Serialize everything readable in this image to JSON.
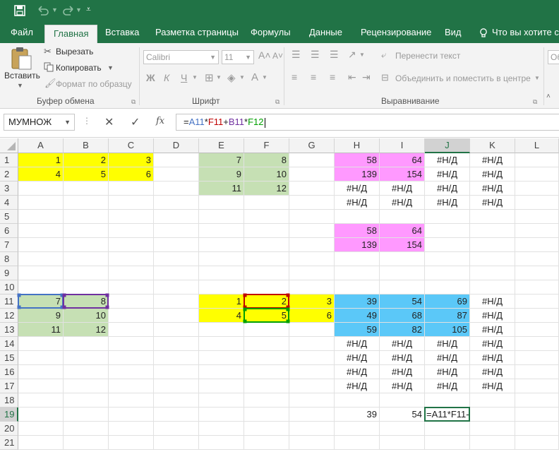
{
  "colors": {
    "accent": "#217346",
    "yellow": "#ffff00",
    "green": "#c6e0b4",
    "pink": "#ff99ff",
    "blue": "#5bc8f8",
    "ref_blue": "#4472c4",
    "ref_purple": "#7030a0",
    "ref_red": "#c00000",
    "ref_green": "#00a000"
  },
  "tabs": [
    "Файл",
    "Главная",
    "Вставка",
    "Разметка страницы",
    "Формулы",
    "Данные",
    "Рецензирование",
    "Вид",
    "Что вы хотите сде"
  ],
  "ribbon": {
    "paste": "Вставить",
    "cut": "Вырезать",
    "copy": "Копировать",
    "format_painter": "Формат по образцу",
    "clipboard_group": "Буфер обмена",
    "font_name": "Calibri",
    "font_size": "11",
    "font_group": "Шрифт",
    "wrap_text": "Перенести текст",
    "merge_center": "Объединить и поместить в центре",
    "alignment_group": "Выравнивание",
    "right_edge": "Об"
  },
  "namebox": "МУМНОЖ",
  "formula": [
    {
      "t": "=",
      "c": "#222222"
    },
    {
      "t": "A11",
      "c": "#4472c4"
    },
    {
      "t": "*",
      "c": "#222222"
    },
    {
      "t": "F11",
      "c": "#c00000"
    },
    {
      "t": "+",
      "c": "#222222"
    },
    {
      "t": "B11",
      "c": "#7030a0"
    },
    {
      "t": "*",
      "c": "#222222"
    },
    {
      "t": "F12",
      "c": "#00a000"
    }
  ],
  "columns": [
    "A",
    "B",
    "C",
    "D",
    "E",
    "F",
    "G",
    "H",
    "I",
    "J",
    "K",
    "L"
  ],
  "rows": [
    "1",
    "2",
    "3",
    "4",
    "5",
    "6",
    "7",
    "8",
    "9",
    "10",
    "11",
    "12",
    "13",
    "14",
    "15",
    "16",
    "17",
    "18",
    "19",
    "20",
    "21"
  ],
  "cells": [
    {
      "r": 1,
      "c": "A",
      "v": "1",
      "bg": "yellow"
    },
    {
      "r": 1,
      "c": "B",
      "v": "2",
      "bg": "yellow"
    },
    {
      "r": 1,
      "c": "C",
      "v": "3",
      "bg": "yellow"
    },
    {
      "r": 2,
      "c": "A",
      "v": "4",
      "bg": "yellow"
    },
    {
      "r": 2,
      "c": "B",
      "v": "5",
      "bg": "yellow"
    },
    {
      "r": 2,
      "c": "C",
      "v": "6",
      "bg": "yellow"
    },
    {
      "r": 1,
      "c": "E",
      "v": "7",
      "bg": "green"
    },
    {
      "r": 1,
      "c": "F",
      "v": "8",
      "bg": "green"
    },
    {
      "r": 2,
      "c": "E",
      "v": "9",
      "bg": "green"
    },
    {
      "r": 2,
      "c": "F",
      "v": "10",
      "bg": "green"
    },
    {
      "r": 3,
      "c": "E",
      "v": "11",
      "bg": "green"
    },
    {
      "r": 3,
      "c": "F",
      "v": "12",
      "bg": "green"
    },
    {
      "r": 1,
      "c": "H",
      "v": "58",
      "bg": "pink"
    },
    {
      "r": 1,
      "c": "I",
      "v": "64",
      "bg": "pink"
    },
    {
      "r": 1,
      "c": "J",
      "v": "#Н/Д",
      "a": "c"
    },
    {
      "r": 1,
      "c": "K",
      "v": "#Н/Д",
      "a": "c"
    },
    {
      "r": 2,
      "c": "H",
      "v": "139",
      "bg": "pink"
    },
    {
      "r": 2,
      "c": "I",
      "v": "154",
      "bg": "pink"
    },
    {
      "r": 2,
      "c": "J",
      "v": "#Н/Д",
      "a": "c"
    },
    {
      "r": 2,
      "c": "K",
      "v": "#Н/Д",
      "a": "c"
    },
    {
      "r": 3,
      "c": "H",
      "v": "#Н/Д",
      "a": "c"
    },
    {
      "r": 3,
      "c": "I",
      "v": "#Н/Д",
      "a": "c"
    },
    {
      "r": 3,
      "c": "J",
      "v": "#Н/Д",
      "a": "c"
    },
    {
      "r": 3,
      "c": "K",
      "v": "#Н/Д",
      "a": "c"
    },
    {
      "r": 4,
      "c": "H",
      "v": "#Н/Д",
      "a": "c"
    },
    {
      "r": 4,
      "c": "I",
      "v": "#Н/Д",
      "a": "c"
    },
    {
      "r": 4,
      "c": "J",
      "v": "#Н/Д",
      "a": "c"
    },
    {
      "r": 4,
      "c": "K",
      "v": "#Н/Д",
      "a": "c"
    },
    {
      "r": 6,
      "c": "H",
      "v": "58",
      "bg": "pink"
    },
    {
      "r": 6,
      "c": "I",
      "v": "64",
      "bg": "pink"
    },
    {
      "r": 7,
      "c": "H",
      "v": "139",
      "bg": "pink"
    },
    {
      "r": 7,
      "c": "I",
      "v": "154",
      "bg": "pink"
    },
    {
      "r": 11,
      "c": "A",
      "v": "7",
      "bg": "green"
    },
    {
      "r": 11,
      "c": "B",
      "v": "8",
      "bg": "green"
    },
    {
      "r": 12,
      "c": "A",
      "v": "9",
      "bg": "green"
    },
    {
      "r": 12,
      "c": "B",
      "v": "10",
      "bg": "green"
    },
    {
      "r": 13,
      "c": "A",
      "v": "11",
      "bg": "green"
    },
    {
      "r": 13,
      "c": "B",
      "v": "12",
      "bg": "green"
    },
    {
      "r": 11,
      "c": "E",
      "v": "1",
      "bg": "yellow"
    },
    {
      "r": 11,
      "c": "F",
      "v": "2",
      "bg": "yellow"
    },
    {
      "r": 11,
      "c": "G",
      "v": "3",
      "bg": "yellow"
    },
    {
      "r": 12,
      "c": "E",
      "v": "4",
      "bg": "yellow"
    },
    {
      "r": 12,
      "c": "F",
      "v": "5",
      "bg": "yellow"
    },
    {
      "r": 12,
      "c": "G",
      "v": "6",
      "bg": "yellow"
    },
    {
      "r": 11,
      "c": "H",
      "v": "39",
      "bg": "blue"
    },
    {
      "r": 11,
      "c": "I",
      "v": "54",
      "bg": "blue"
    },
    {
      "r": 11,
      "c": "J",
      "v": "69",
      "bg": "blue"
    },
    {
      "r": 11,
      "c": "K",
      "v": "#Н/Д",
      "a": "c"
    },
    {
      "r": 12,
      "c": "H",
      "v": "49",
      "bg": "blue"
    },
    {
      "r": 12,
      "c": "I",
      "v": "68",
      "bg": "blue"
    },
    {
      "r": 12,
      "c": "J",
      "v": "87",
      "bg": "blue"
    },
    {
      "r": 12,
      "c": "K",
      "v": "#Н/Д",
      "a": "c"
    },
    {
      "r": 13,
      "c": "H",
      "v": "59",
      "bg": "blue"
    },
    {
      "r": 13,
      "c": "I",
      "v": "82",
      "bg": "blue"
    },
    {
      "r": 13,
      "c": "J",
      "v": "105",
      "bg": "blue"
    },
    {
      "r": 13,
      "c": "K",
      "v": "#Н/Д",
      "a": "c"
    },
    {
      "r": 14,
      "c": "H",
      "v": "#Н/Д",
      "a": "c"
    },
    {
      "r": 14,
      "c": "I",
      "v": "#Н/Д",
      "a": "c"
    },
    {
      "r": 14,
      "c": "J",
      "v": "#Н/Д",
      "a": "c"
    },
    {
      "r": 14,
      "c": "K",
      "v": "#Н/Д",
      "a": "c"
    },
    {
      "r": 15,
      "c": "H",
      "v": "#Н/Д",
      "a": "c"
    },
    {
      "r": 15,
      "c": "I",
      "v": "#Н/Д",
      "a": "c"
    },
    {
      "r": 15,
      "c": "J",
      "v": "#Н/Д",
      "a": "c"
    },
    {
      "r": 15,
      "c": "K",
      "v": "#Н/Д",
      "a": "c"
    },
    {
      "r": 16,
      "c": "H",
      "v": "#Н/Д",
      "a": "c"
    },
    {
      "r": 16,
      "c": "I",
      "v": "#Н/Д",
      "a": "c"
    },
    {
      "r": 16,
      "c": "J",
      "v": "#Н/Д",
      "a": "c"
    },
    {
      "r": 16,
      "c": "K",
      "v": "#Н/Д",
      "a": "c"
    },
    {
      "r": 17,
      "c": "H",
      "v": "#Н/Д",
      "a": "c"
    },
    {
      "r": 17,
      "c": "I",
      "v": "#Н/Д",
      "a": "c"
    },
    {
      "r": 17,
      "c": "J",
      "v": "#Н/Д",
      "a": "c"
    },
    {
      "r": 17,
      "c": "K",
      "v": "#Н/Д",
      "a": "c"
    },
    {
      "r": 19,
      "c": "H",
      "v": "39"
    },
    {
      "r": 19,
      "c": "I",
      "v": "54"
    },
    {
      "r": 19,
      "c": "J",
      "v": "=A11*F11-",
      "a": "l"
    }
  ],
  "active_cell": "J19"
}
